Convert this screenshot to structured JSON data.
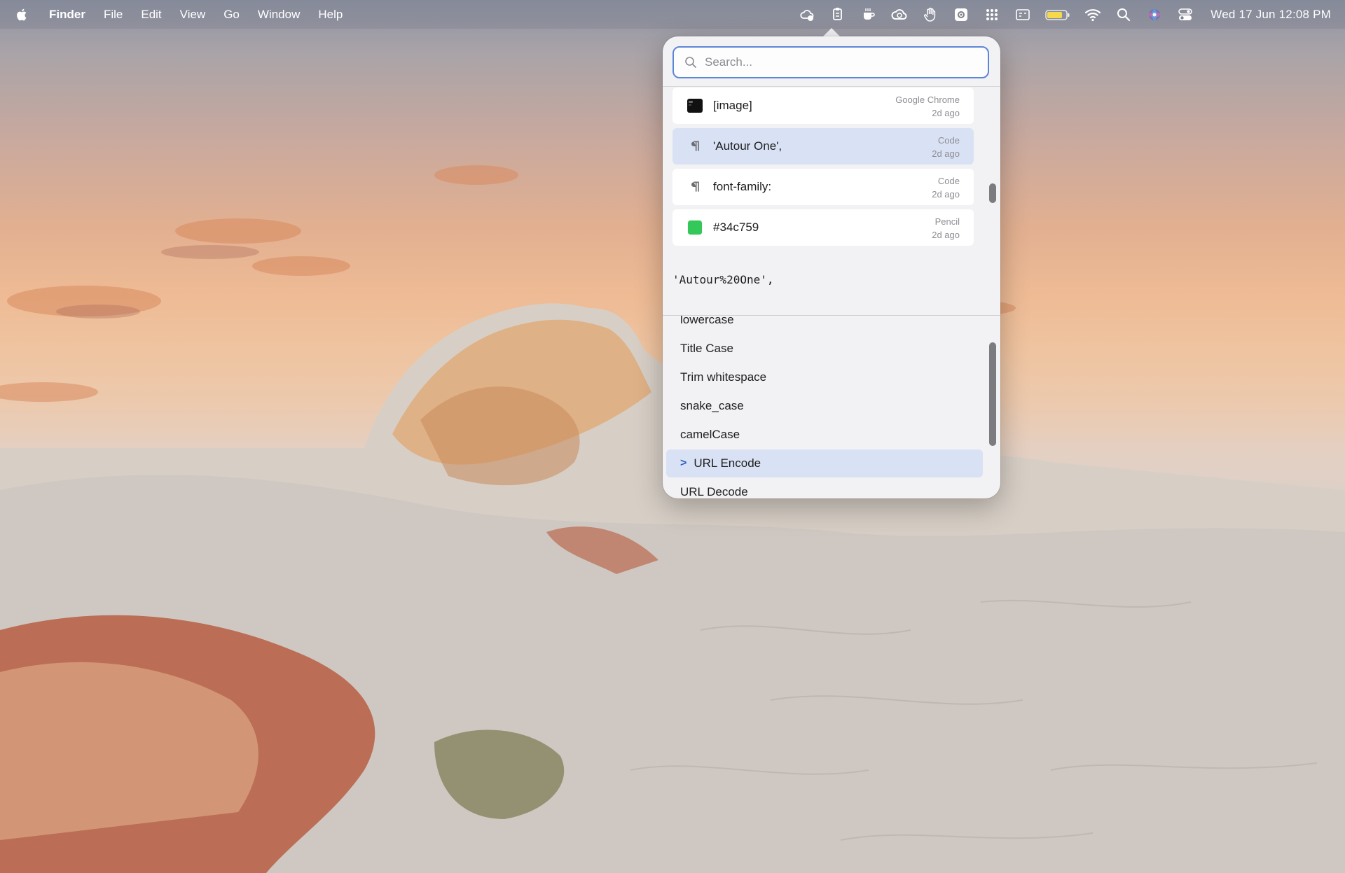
{
  "menubar": {
    "app_name": "Finder",
    "menus": [
      "File",
      "Edit",
      "View",
      "Go",
      "Window",
      "Help"
    ],
    "status_icons": [
      "weather-icon",
      "clipboard-manager-icon",
      "coffee-icon",
      "creative-cloud-icon",
      "hand-icon",
      "gear-badge-icon",
      "grid-icon",
      "display-icon",
      "battery-icon",
      "wifi-icon",
      "spotlight-search-icon",
      "siri-icon",
      "control-center-icon"
    ],
    "battery_color": "#f5d94a",
    "clock": "Wed 17 Jun  12:08 PM"
  },
  "popover": {
    "search": {
      "placeholder": "Search...",
      "value": ""
    },
    "clip_items": [
      {
        "text": "[image]",
        "source": "Google Chrome",
        "time": "2d ago",
        "icon": "image-thumbnail-icon",
        "selected": false
      },
      {
        "text": "'Autour One',",
        "source": "Code",
        "time": "2d ago",
        "icon": "paragraph-icon",
        "selected": true
      },
      {
        "text": "font-family:",
        "source": "Code",
        "time": "2d ago",
        "icon": "paragraph-icon",
        "selected": false
      },
      {
        "text": "#34c759",
        "source": "Pencil",
        "time": "2d ago",
        "icon": "color-swatch-icon",
        "swatch": "#34c759",
        "selected": false
      }
    ],
    "preview": "'Autour%20One',",
    "transforms": [
      "lowercase",
      "Title Case",
      "Trim whitespace",
      "snake_case",
      "camelCase",
      "URL Encode",
      "URL Decode"
    ],
    "selected_transform": "URL Encode",
    "selected_marker": ">",
    "accent": "#5c87d6",
    "selection_bg": "#d9e2f4"
  }
}
